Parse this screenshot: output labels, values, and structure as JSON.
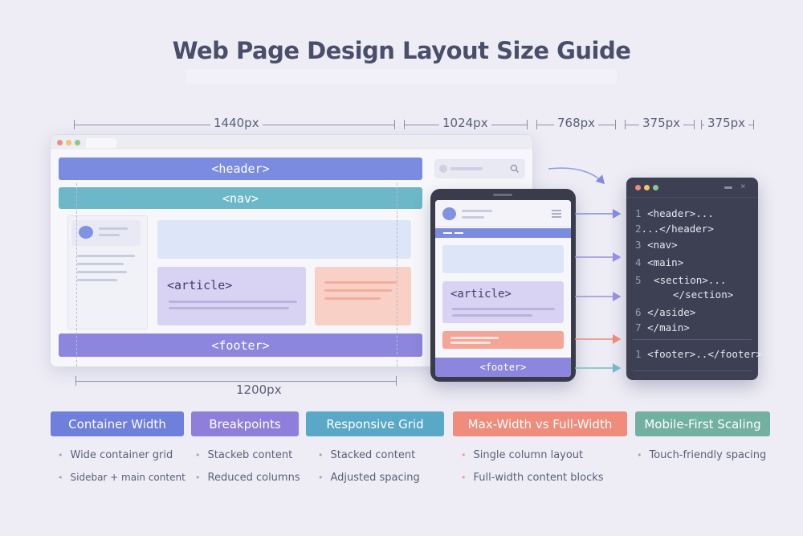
{
  "title": "Web Page Design Layout Size Guide",
  "widths": {
    "w1440": "1440px",
    "w1024": "1024px",
    "w768": "768px",
    "w375a": "375px",
    "w375b": "375px",
    "container": "1200px"
  },
  "desktop": {
    "header": "<header>",
    "nav": "<nav>",
    "article": "<article>",
    "footer": "<footer>"
  },
  "tablet": {
    "article": "<article>",
    "footer": "<footer>"
  },
  "code": {
    "lines": [
      {
        "num": "1",
        "text": "<header>..."
      },
      {
        "num": "2",
        "text": "...</header>"
      },
      {
        "num": "3",
        "text": "<nav>"
      },
      {
        "num": "4",
        "text": "<main>"
      },
      {
        "num": "5",
        "text": "<section>..."
      },
      {
        "num": "",
        "text": "</section>"
      },
      {
        "num": "6",
        "text": "</aside>"
      },
      {
        "num": "7",
        "text": "</main>"
      },
      {
        "num": "1",
        "text": "<footer>..</footer>"
      }
    ]
  },
  "categories": [
    {
      "label": "Container Width",
      "color": "#6e7fdc",
      "bullets": [
        "Wide container grid",
        "Sidebar + main content"
      ]
    },
    {
      "label": "Breakpoints",
      "color": "#8f7fda",
      "bullets": [
        "Stackeb content",
        "Reduced columns"
      ]
    },
    {
      "label": "Responsive Grid",
      "color": "#5aa8c8",
      "bullets": [
        "Stacked content",
        "Adjusted spacing"
      ]
    },
    {
      "label": "Max-Width vs Full-Width",
      "color": "#ef8c7c",
      "bullets": [
        "Single column layout",
        "Full-width content blocks"
      ]
    },
    {
      "label": "Mobile-First Scaling",
      "color": "#72b0a0",
      "bullets": [
        "Touch-friendly spacing"
      ]
    }
  ],
  "colors": {
    "header": "#7b8be0",
    "nav": "#6cb7c8",
    "article": "#d9d3f3",
    "footer": "#8d86de",
    "code_bg": "#3d3f52"
  }
}
